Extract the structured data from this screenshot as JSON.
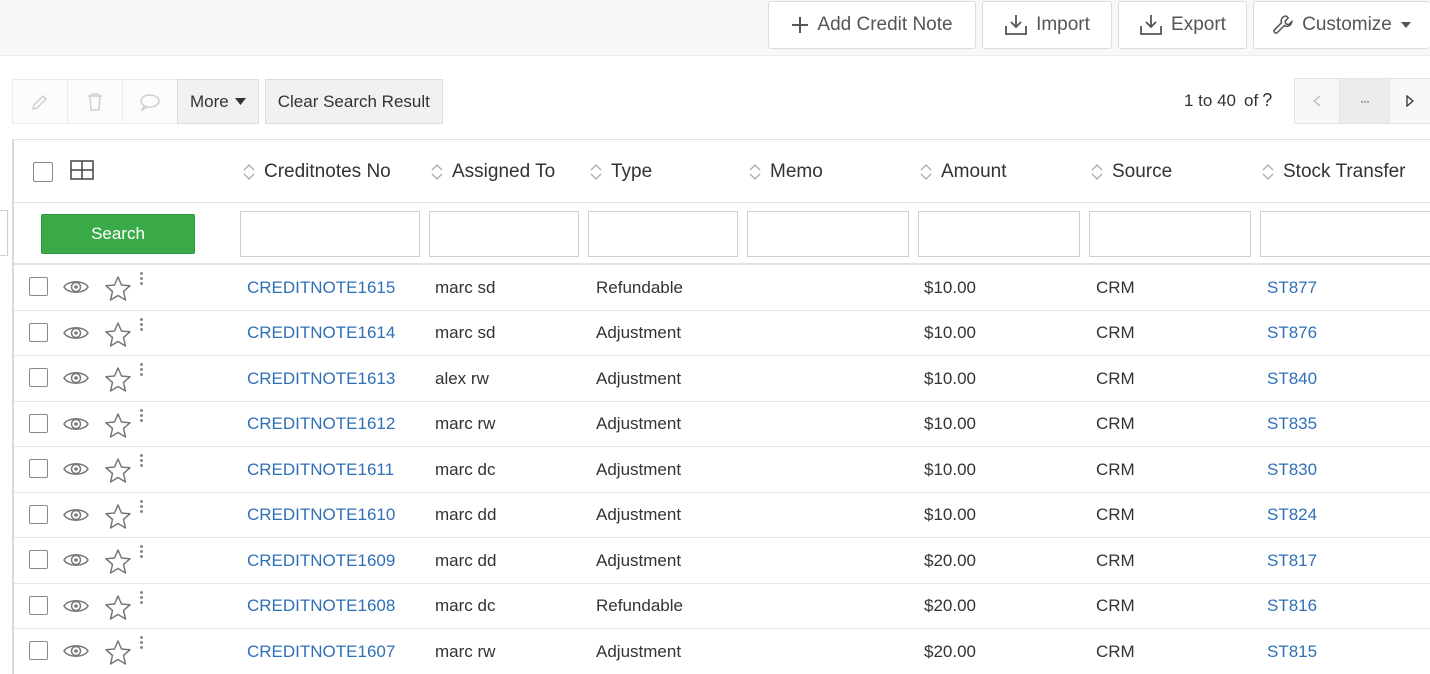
{
  "top_actions": {
    "add_label": "Add Credit Note",
    "import_label": "Import",
    "export_label": "Export",
    "customize_label": "Customize"
  },
  "toolbar": {
    "more_label": "More",
    "clear_label": "Clear Search Result"
  },
  "pager": {
    "range": "1 to 40",
    "of_label": "of",
    "total": "?",
    "ellipsis": "···"
  },
  "grid": {
    "search_label": "Search",
    "columns": [
      "Creditnotes No",
      "Assigned To",
      "Type",
      "Memo",
      "Amount",
      "Source",
      "Stock Transfer"
    ],
    "rows": [
      {
        "no": "CREDITNOTE1615",
        "assigned": "marc sd",
        "type": "Refundable",
        "memo": "",
        "amount": "$10.00",
        "source": "CRM",
        "stock": "ST877"
      },
      {
        "no": "CREDITNOTE1614",
        "assigned": "marc sd",
        "type": "Adjustment",
        "memo": "",
        "amount": "$10.00",
        "source": "CRM",
        "stock": "ST876"
      },
      {
        "no": "CREDITNOTE1613",
        "assigned": "alex rw",
        "type": "Adjustment",
        "memo": "",
        "amount": "$10.00",
        "source": "CRM",
        "stock": "ST840"
      },
      {
        "no": "CREDITNOTE1612",
        "assigned": "marc rw",
        "type": "Adjustment",
        "memo": "",
        "amount": "$10.00",
        "source": "CRM",
        "stock": "ST835"
      },
      {
        "no": "CREDITNOTE1611",
        "assigned": "marc dc",
        "type": "Adjustment",
        "memo": "",
        "amount": "$10.00",
        "source": "CRM",
        "stock": "ST830"
      },
      {
        "no": "CREDITNOTE1610",
        "assigned": "marc dd",
        "type": "Adjustment",
        "memo": "",
        "amount": "$10.00",
        "source": "CRM",
        "stock": "ST824"
      },
      {
        "no": "CREDITNOTE1609",
        "assigned": "marc dd",
        "type": "Adjustment",
        "memo": "",
        "amount": "$20.00",
        "source": "CRM",
        "stock": "ST817"
      },
      {
        "no": "CREDITNOTE1608",
        "assigned": "marc dc",
        "type": "Refundable",
        "memo": "",
        "amount": "$20.00",
        "source": "CRM",
        "stock": "ST816"
      },
      {
        "no": "CREDITNOTE1607",
        "assigned": "marc rw",
        "type": "Adjustment",
        "memo": "",
        "amount": "$20.00",
        "source": "CRM",
        "stock": "ST815"
      }
    ]
  },
  "icons": {
    "edit": "pencil-icon",
    "delete": "trash-icon",
    "comment": "comment-icon",
    "view": "eye-icon",
    "favorite": "star-icon",
    "actions": "kebab-icon"
  },
  "colors": {
    "link": "#2f6fb8",
    "search_button": "#3aaa48"
  }
}
